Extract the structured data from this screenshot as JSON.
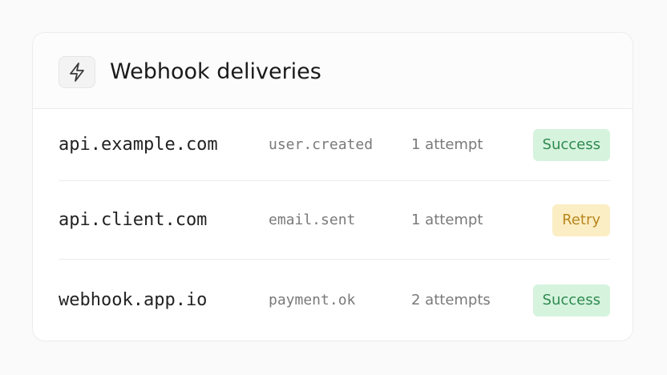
{
  "header": {
    "icon": "lightning-bolt-icon",
    "title": "Webhook deliveries"
  },
  "deliveries": [
    {
      "host": "api.example.com",
      "event": "user.created",
      "attempts": "1 attempt",
      "status": "Success",
      "status_kind": "success"
    },
    {
      "host": "api.client.com",
      "event": "email.sent",
      "attempts": "1 attempt",
      "status": "Retry",
      "status_kind": "retry"
    },
    {
      "host": "webhook.app.io",
      "event": "payment.ok",
      "attempts": "2 attempts",
      "status": "Success",
      "status_kind": "success"
    }
  ],
  "colors": {
    "success_bg": "#d6f3de",
    "success_text": "#2f8a4f",
    "retry_bg": "#fbeec4",
    "retry_text": "#b8861f"
  }
}
